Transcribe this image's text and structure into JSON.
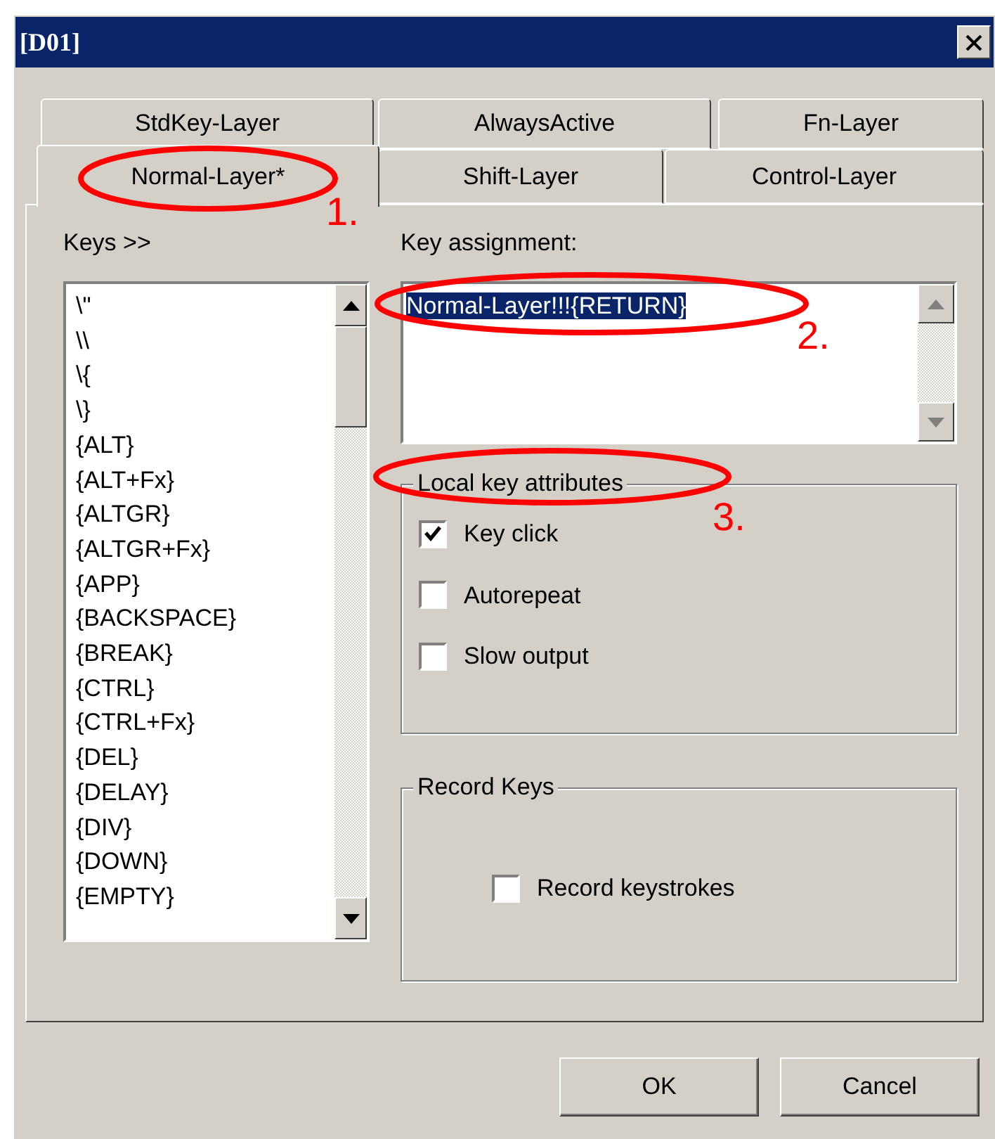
{
  "window": {
    "title": "[D01]"
  },
  "tab_rows": [
    [
      {
        "label": "StdKey-Layer",
        "selected": false
      },
      {
        "label": "AlwaysActive",
        "selected": false
      },
      {
        "label": "Fn-Layer",
        "selected": false
      }
    ],
    [
      {
        "label": "Normal-Layer*",
        "selected": true
      },
      {
        "label": "Shift-Layer",
        "selected": false
      },
      {
        "label": "Control-Layer",
        "selected": false
      }
    ]
  ],
  "keys": {
    "label": "Keys >>",
    "items": [
      "\\\"",
      "\\\\",
      "\\{",
      "\\}",
      "{ALT}",
      "{ALT+Fx}",
      "{ALTGR}",
      "{ALTGR+Fx}",
      "{APP}",
      "{BACKSPACE}",
      "{BREAK}",
      "{CTRL}",
      "{CTRL+Fx}",
      "{DEL}",
      "{DELAY}",
      "{DIV}",
      "{DOWN}",
      "{EMPTY}"
    ]
  },
  "key_assignment": {
    "label": "Key assignment:",
    "value": "Normal-Layer!!!{RETURN}"
  },
  "local_key_attributes": {
    "title": "Local key attributes",
    "options": [
      {
        "label": "Key click",
        "checked": true
      },
      {
        "label": "Autorepeat",
        "checked": false
      },
      {
        "label": "Slow output",
        "checked": false
      }
    ]
  },
  "record_keys": {
    "title": "Record Keys",
    "options": [
      {
        "label": "Record keystrokes",
        "checked": false
      }
    ]
  },
  "buttons": [
    "OK",
    "Cancel"
  ],
  "annotations": [
    "1.",
    "2.",
    "3."
  ]
}
